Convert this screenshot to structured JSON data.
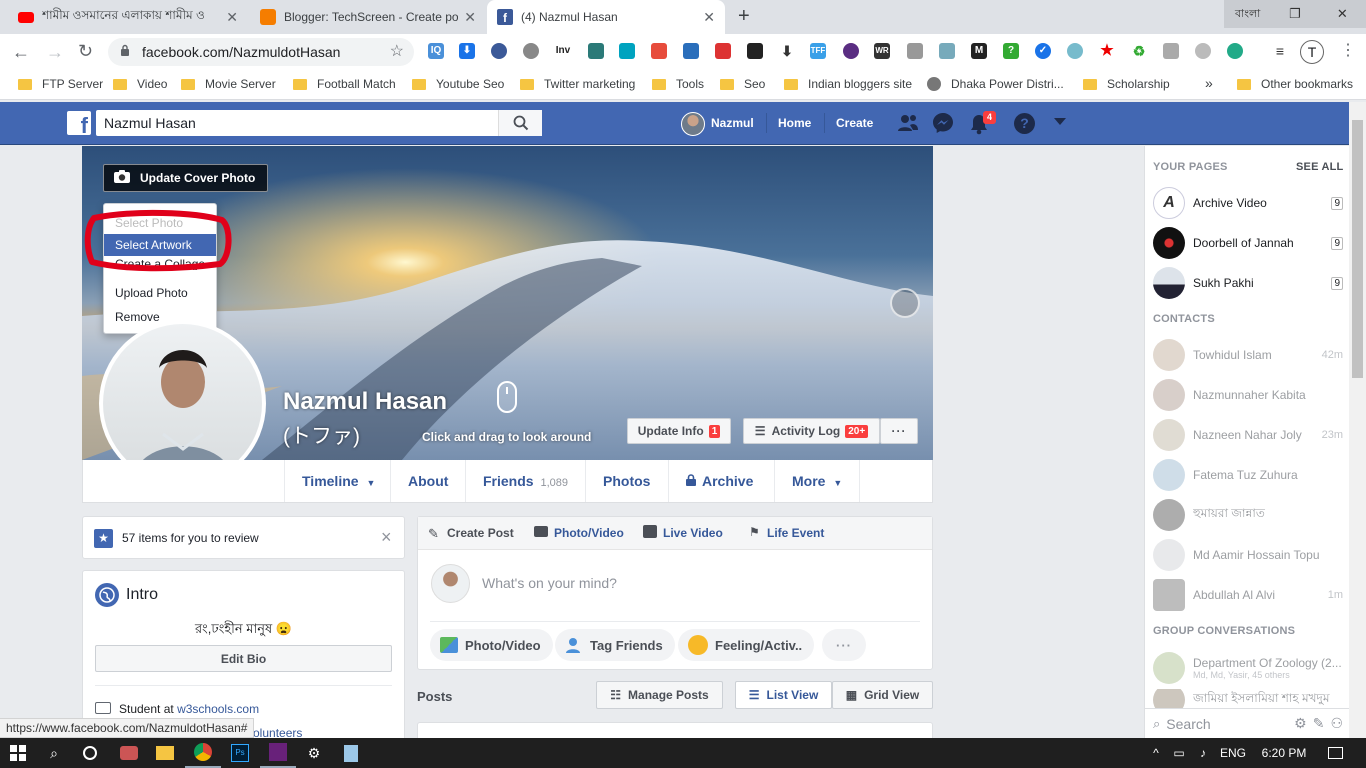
{
  "browser": {
    "tabs": [
      {
        "title": "শামীম ওসমানের এলাকায় শামীম ও"
      },
      {
        "title": "Blogger: TechScreen - Create pos"
      },
      {
        "title": "(4) Nazmul Hasan"
      }
    ],
    "new_tab": "+",
    "url": "facebook.com/NazmuldotHasan",
    "window_lang": "বাংলা",
    "bookmarks": [
      "FTP Server",
      "Video",
      "Movie Server",
      "Football Match",
      "Youtube Seo",
      "Twitter marketing",
      "Tools",
      "Seo",
      "Indian bloggers site",
      "Dhaka Power Distri...",
      "Scholarship"
    ],
    "more_bookmarks": "»",
    "other_bookmarks": "Other bookmarks",
    "status_url": "https://www.facebook.com/NazmuldotHasan#"
  },
  "fb": {
    "logo": "f",
    "search_value": "Nazmul Hasan",
    "user": "Nazmul",
    "home": "Home",
    "create": "Create",
    "notif_count": "4"
  },
  "cover": {
    "update_cover_label": "Update Cover Photo",
    "menu": [
      "Select Photo",
      "Select Artwork",
      "Create a Collage",
      "Upload Photo",
      "Remove"
    ],
    "drag_hint": "Click and drag to look around",
    "name": "Nazmul Hasan",
    "alt_name": "(トファ)",
    "update_info": "Update Info",
    "update_info_badge": "1",
    "activity_log": "Activity Log",
    "activity_badge": "20+",
    "more_dots": "···"
  },
  "profile_tabs": [
    {
      "label": "Timeline",
      "caret": "▼"
    },
    {
      "label": "About"
    },
    {
      "label": "Friends",
      "count": "1,089"
    },
    {
      "label": "Photos"
    },
    {
      "label": "Archive"
    },
    {
      "label": "More",
      "caret": "▼"
    }
  ],
  "review": {
    "text": "57 items for you to review",
    "close": "×"
  },
  "intro": {
    "title": "Intro",
    "bio": "রং,ঢংহীন মানুষ 😦",
    "edit_bio": "Edit Bio",
    "student_prefix": "Student at",
    "student_link": "w3schools.com",
    "volunteers": "olunteers"
  },
  "composer": {
    "tabs": [
      "Create Post",
      "Photo/Video",
      "Live Video",
      "Life Event"
    ],
    "placeholder": "What's on your mind?",
    "actions": [
      "Photo/Video",
      "Tag Friends",
      "Feeling/Activ..."
    ],
    "more": "···"
  },
  "posts": {
    "title": "Posts",
    "manage": "Manage Posts",
    "list_view": "List View",
    "grid_view": "Grid View"
  },
  "sidebar": {
    "your_pages": "YOUR PAGES",
    "see_all": "SEE ALL",
    "pages": [
      {
        "name": "Archive Video",
        "count": "9"
      },
      {
        "name": "Doorbell of Jannah",
        "count": "9"
      },
      {
        "name": "Sukh Pakhi",
        "count": "9"
      }
    ],
    "contacts_title": "CONTACTS",
    "contacts": [
      {
        "name": "Towhidul Islam",
        "time": "42m"
      },
      {
        "name": "Nazmunnaher Kabita",
        "time": ""
      },
      {
        "name": "Nazneen Nahar Joly",
        "time": "23m"
      },
      {
        "name": "Fatema Tuz Zuhura",
        "time": ""
      },
      {
        "name": "হুমায়রা জান্নাত",
        "time": ""
      },
      {
        "name": "Md Aamir Hossain Topu",
        "time": ""
      },
      {
        "name": "Abdullah Al Alvi",
        "time": "1m"
      }
    ],
    "groups_title": "GROUP CONVERSATIONS",
    "groups": [
      {
        "name": "Department Of Zoology (2...",
        "sub": "Md, Md, Yasir, 45 others"
      },
      {
        "name": "জামিয়া ইসলামিয়া শাহ মখদুম",
        "sub": ""
      }
    ],
    "search_placeholder": "Search"
  },
  "taskbar": {
    "lang": "ENG",
    "time": "6:20 PM"
  },
  "colors": {
    "fb_blue": "#4267b2",
    "link": "#365899",
    "badge": "#fa3e3e",
    "highlight_ring": "#e0001a"
  }
}
